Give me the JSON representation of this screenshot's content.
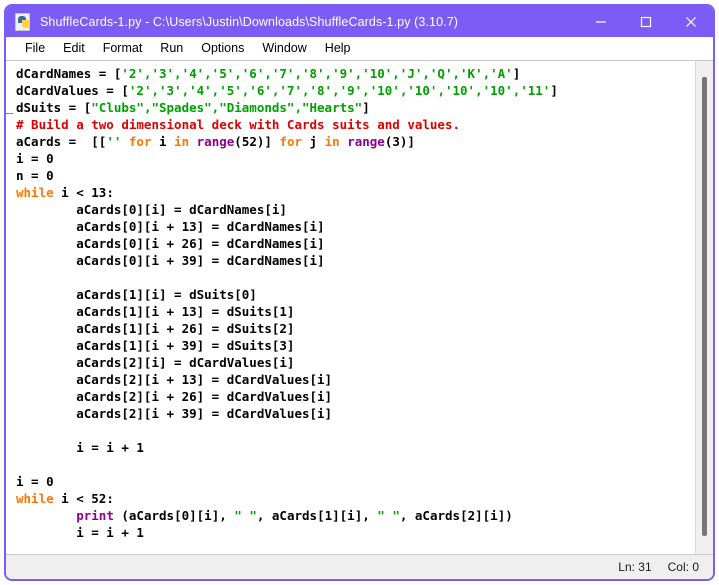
{
  "window": {
    "title": "ShuffleCards-1.py - C:\\Users\\Justin\\Downloads\\ShuffleCards-1.py (3.10.7)",
    "icon": "python-file-icon",
    "titlebar_color": "#7B5CF5",
    "border_color": "#7B5CF5",
    "controls": {
      "minimize": "minimize-button",
      "maximize": "maximize-button",
      "close": "close-button"
    }
  },
  "menubar": {
    "items": [
      {
        "label": "File"
      },
      {
        "label": "Edit"
      },
      {
        "label": "Format"
      },
      {
        "label": "Run"
      },
      {
        "label": "Options"
      },
      {
        "label": "Window"
      },
      {
        "label": "Help"
      }
    ]
  },
  "editor": {
    "language": "python",
    "colors": {
      "keyword": "#FF7700",
      "string": "#00A000",
      "comment": "#DD0000",
      "builtin": "#900090",
      "text": "#000000",
      "background": "#ffffff"
    },
    "lines": [
      [
        {
          "t": "dCardNames = ["
        },
        {
          "t": "'2','3','4','5','6','7','8','9','10','J','Q','K','A'",
          "c": "str"
        },
        {
          "t": "]"
        }
      ],
      [
        {
          "t": "dCardValues = ["
        },
        {
          "t": "'2','3','4','5','6','7','8','9','10','10','10','10','11'",
          "c": "str"
        },
        {
          "t": "]"
        }
      ],
      [
        {
          "t": "dSuits = ["
        },
        {
          "t": "\"Clubs\",\"Spades\",\"Diamonds\",\"Hearts\"",
          "c": "str"
        },
        {
          "t": "]"
        }
      ],
      [
        {
          "t": "# Build a two dimensional deck with Cards suits and values.",
          "c": "cmt"
        }
      ],
      [
        {
          "t": "aCards =  [["
        },
        {
          "t": "''",
          "c": "str"
        },
        {
          "t": " "
        },
        {
          "t": "for",
          "c": "kw"
        },
        {
          "t": " i "
        },
        {
          "t": "in",
          "c": "kw"
        },
        {
          "t": " "
        },
        {
          "t": "range",
          "c": "bi"
        },
        {
          "t": "(52)] "
        },
        {
          "t": "for",
          "c": "kw"
        },
        {
          "t": " j "
        },
        {
          "t": "in",
          "c": "kw"
        },
        {
          "t": " "
        },
        {
          "t": "range",
          "c": "bi"
        },
        {
          "t": "(3)]"
        }
      ],
      [
        {
          "t": "i = 0"
        }
      ],
      [
        {
          "t": "n = 0"
        }
      ],
      [
        {
          "t": "while",
          "c": "kw"
        },
        {
          "t": " i < 13:"
        }
      ],
      [
        {
          "t": "        aCards[0][i] = dCardNames[i]"
        }
      ],
      [
        {
          "t": "        aCards[0][i + 13] = dCardNames[i]"
        }
      ],
      [
        {
          "t": "        aCards[0][i + 26] = dCardNames[i]"
        }
      ],
      [
        {
          "t": "        aCards[0][i + 39] = dCardNames[i]"
        }
      ],
      [
        {
          "t": ""
        }
      ],
      [
        {
          "t": "        aCards[1][i] = dSuits[0]"
        }
      ],
      [
        {
          "t": "        aCards[1][i + 13] = dSuits[1]"
        }
      ],
      [
        {
          "t": "        aCards[1][i + 26] = dSuits[2]"
        }
      ],
      [
        {
          "t": "        aCards[1][i + 39] = dSuits[3]"
        }
      ],
      [
        {
          "t": "        aCards[2][i] = dCardValues[i]"
        }
      ],
      [
        {
          "t": "        aCards[2][i + 13] = dCardValues[i]"
        }
      ],
      [
        {
          "t": "        aCards[2][i + 26] = dCardValues[i]"
        }
      ],
      [
        {
          "t": "        aCards[2][i + 39] = dCardValues[i]"
        }
      ],
      [
        {
          "t": ""
        }
      ],
      [
        {
          "t": "        i = i + 1"
        }
      ],
      [
        {
          "t": ""
        }
      ],
      [
        {
          "t": "i = 0"
        }
      ],
      [
        {
          "t": "while",
          "c": "kw"
        },
        {
          "t": " i < 52:"
        }
      ],
      [
        {
          "t": "        "
        },
        {
          "t": "print",
          "c": "bi"
        },
        {
          "t": " (aCards[0][i], "
        },
        {
          "t": "\" \"",
          "c": "str"
        },
        {
          "t": ", aCards[1][i], "
        },
        {
          "t": "\" \"",
          "c": "str"
        },
        {
          "t": ", aCards[2][i])"
        }
      ],
      [
        {
          "t": "        i = i + 1"
        }
      ]
    ]
  },
  "scrollbar": {
    "orientation": "vertical",
    "thumb": "scroll-thumb"
  },
  "statusbar": {
    "line_label": "Ln: 31",
    "col_label": "Col: 0"
  }
}
